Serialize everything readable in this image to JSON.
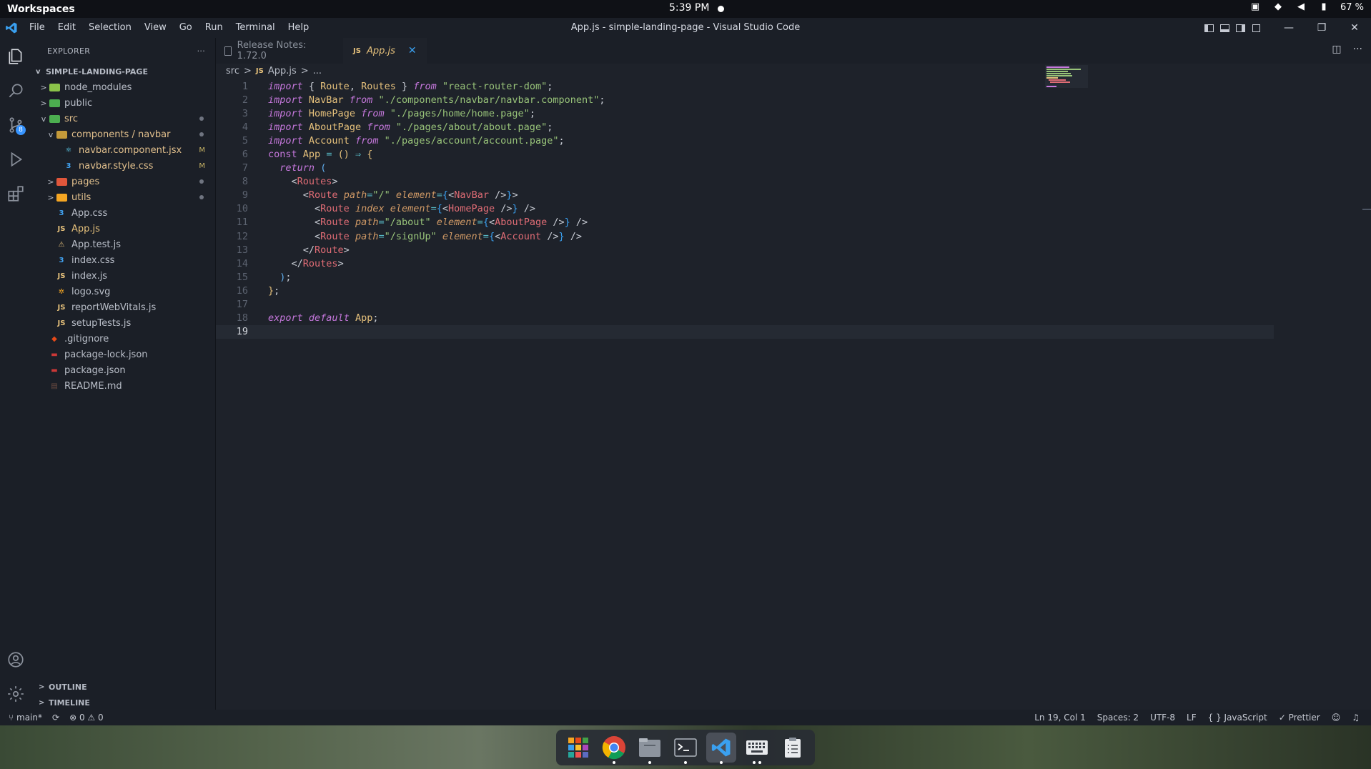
{
  "system_bar": {
    "workspaces": "Workspaces",
    "time": "5:39 PM",
    "battery": "67 %"
  },
  "titlebar": {
    "menu": [
      "File",
      "Edit",
      "Selection",
      "View",
      "Go",
      "Run",
      "Terminal",
      "Help"
    ],
    "window_title": "App.js - simple-landing-page - Visual Studio Code"
  },
  "activity_bar": {
    "source_control_badge": "8"
  },
  "sidebar": {
    "header": "EXPLORER",
    "more": "···",
    "project": "SIMPLE-LANDING-PAGE",
    "tree": [
      {
        "label": "node_modules",
        "indent": 1,
        "chev": ">",
        "icon": "folder",
        "color": "#8bc34a"
      },
      {
        "label": "public",
        "indent": 1,
        "chev": ">",
        "icon": "folder",
        "color": "#4caf50"
      },
      {
        "label": "src",
        "indent": 1,
        "chev": "v",
        "icon": "folder",
        "color": "#4caf50",
        "dot": true,
        "mod": true
      },
      {
        "label": "components / navbar",
        "indent": 2,
        "chev": "v",
        "icon": "folder",
        "color": "#c49a3a",
        "dot": true,
        "mod": true
      },
      {
        "label": "navbar.component.jsx",
        "indent": 3,
        "chev": "",
        "icon": "react",
        "color": "#61dafb",
        "mark": "M",
        "mod": true
      },
      {
        "label": "navbar.style.css",
        "indent": 3,
        "chev": "",
        "icon": "css",
        "color": "#42a5f5",
        "mark": "M",
        "mod": true
      },
      {
        "label": "pages",
        "indent": 2,
        "chev": ">",
        "icon": "folder",
        "color": "#e0563b",
        "dot": true,
        "mod": true
      },
      {
        "label": "utils",
        "indent": 2,
        "chev": ">",
        "icon": "folder",
        "color": "#f5a623",
        "dot": true,
        "mod": true
      },
      {
        "label": "App.css",
        "indent": 2,
        "chev": "",
        "icon": "css",
        "color": "#42a5f5"
      },
      {
        "label": "App.js",
        "indent": 2,
        "chev": "",
        "icon": "js",
        "color": "#e5c07b",
        "selected": true
      },
      {
        "label": "App.test.js",
        "indent": 2,
        "chev": "",
        "icon": "test",
        "color": "#e5c07b"
      },
      {
        "label": "index.css",
        "indent": 2,
        "chev": "",
        "icon": "css",
        "color": "#42a5f5"
      },
      {
        "label": "index.js",
        "indent": 2,
        "chev": "",
        "icon": "js",
        "color": "#e5c07b"
      },
      {
        "label": "logo.svg",
        "indent": 2,
        "chev": "",
        "icon": "svg",
        "color": "#f5a623"
      },
      {
        "label": "reportWebVitals.js",
        "indent": 2,
        "chev": "",
        "icon": "js",
        "color": "#e5c07b"
      },
      {
        "label": "setupTests.js",
        "indent": 2,
        "chev": "",
        "icon": "js",
        "color": "#e5c07b"
      },
      {
        "label": ".gitignore",
        "indent": 1,
        "chev": "",
        "icon": "git",
        "color": "#e64a19"
      },
      {
        "label": "package-lock.json",
        "indent": 1,
        "chev": "",
        "icon": "npm",
        "color": "#cb3837"
      },
      {
        "label": "package.json",
        "indent": 1,
        "chev": "",
        "icon": "npm",
        "color": "#cb3837"
      },
      {
        "label": "README.md",
        "indent": 1,
        "chev": "",
        "icon": "md",
        "color": "#6d4c41"
      }
    ],
    "outline": "OUTLINE",
    "timeline": "TIMELINE"
  },
  "editor": {
    "tabs": [
      {
        "label": "Release Notes: 1.72.0",
        "active": false
      },
      {
        "label": "App.js",
        "active": true
      }
    ],
    "breadcrumb": [
      "src",
      "App.js",
      "..."
    ],
    "current_line": 19,
    "lines": [
      [
        [
          "kw",
          "import"
        ],
        [
          "p",
          " { "
        ],
        [
          "id",
          "Route"
        ],
        [
          "p",
          ", "
        ],
        [
          "id",
          "Routes"
        ],
        [
          "p",
          " } "
        ],
        [
          "kw",
          "from"
        ],
        [
          "p",
          " "
        ],
        [
          "str",
          "\"react-router-dom\""
        ],
        [
          "p",
          ";"
        ]
      ],
      [
        [
          "kw",
          "import"
        ],
        [
          "p",
          " "
        ],
        [
          "id",
          "NavBar"
        ],
        [
          "p",
          " "
        ],
        [
          "kw",
          "from"
        ],
        [
          "p",
          " "
        ],
        [
          "str",
          "\"./components/navbar/navbar.component\""
        ],
        [
          "p",
          ";"
        ]
      ],
      [
        [
          "kw",
          "import"
        ],
        [
          "p",
          " "
        ],
        [
          "id",
          "HomePage"
        ],
        [
          "p",
          " "
        ],
        [
          "kw",
          "from"
        ],
        [
          "p",
          " "
        ],
        [
          "str",
          "\"./pages/home/home.page\""
        ],
        [
          "p",
          ";"
        ]
      ],
      [
        [
          "kw",
          "import"
        ],
        [
          "p",
          " "
        ],
        [
          "id",
          "AboutPage"
        ],
        [
          "p",
          " "
        ],
        [
          "kw",
          "from"
        ],
        [
          "p",
          " "
        ],
        [
          "str",
          "\"./pages/about/about.page\""
        ],
        [
          "p",
          ";"
        ]
      ],
      [
        [
          "kw",
          "import"
        ],
        [
          "p",
          " "
        ],
        [
          "id",
          "Account"
        ],
        [
          "p",
          " "
        ],
        [
          "kw",
          "from"
        ],
        [
          "p",
          " "
        ],
        [
          "str",
          "\"./pages/account/account.page\""
        ],
        [
          "p",
          ";"
        ]
      ],
      [
        [
          "kw2",
          "const"
        ],
        [
          "p",
          " "
        ],
        [
          "id",
          "App"
        ],
        [
          "p",
          " "
        ],
        [
          "op",
          "="
        ],
        [
          "p",
          " "
        ],
        [
          "br2",
          "()"
        ],
        [
          "p",
          " "
        ],
        [
          "op",
          "⇒"
        ],
        [
          "p",
          " "
        ],
        [
          "br2",
          "{"
        ]
      ],
      [
        [
          "p",
          "  "
        ],
        [
          "kw",
          "return"
        ],
        [
          "p",
          " "
        ],
        [
          "fn",
          "("
        ]
      ],
      [
        [
          "p",
          "    <"
        ],
        [
          "tag",
          "Routes"
        ],
        [
          "p",
          ">"
        ]
      ],
      [
        [
          "p",
          "      <"
        ],
        [
          "tag",
          "Route"
        ],
        [
          "p",
          " "
        ],
        [
          "attr",
          "path"
        ],
        [
          "op",
          "="
        ],
        [
          "str",
          "\"/\""
        ],
        [
          "p",
          " "
        ],
        [
          "attr",
          "element"
        ],
        [
          "op",
          "="
        ],
        [
          "br",
          "{"
        ],
        [
          "p",
          "<"
        ],
        [
          "tag",
          "NavBar"
        ],
        [
          "p",
          " />"
        ],
        [
          "br",
          "}"
        ],
        [
          "p",
          ">"
        ]
      ],
      [
        [
          "p",
          "        <"
        ],
        [
          "tag",
          "Route"
        ],
        [
          "p",
          " "
        ],
        [
          "attr",
          "index"
        ],
        [
          "p",
          " "
        ],
        [
          "attr",
          "element"
        ],
        [
          "op",
          "="
        ],
        [
          "br",
          "{"
        ],
        [
          "p",
          "<"
        ],
        [
          "tag",
          "HomePage"
        ],
        [
          "p",
          " />"
        ],
        [
          "br",
          "}"
        ],
        [
          "p",
          " />"
        ]
      ],
      [
        [
          "p",
          "        <"
        ],
        [
          "tag",
          "Route"
        ],
        [
          "p",
          " "
        ],
        [
          "attr",
          "path"
        ],
        [
          "op",
          "="
        ],
        [
          "str",
          "\"/about\""
        ],
        [
          "p",
          " "
        ],
        [
          "attr",
          "element"
        ],
        [
          "op",
          "="
        ],
        [
          "br",
          "{"
        ],
        [
          "p",
          "<"
        ],
        [
          "tag",
          "AboutPage"
        ],
        [
          "p",
          " />"
        ],
        [
          "br",
          "}"
        ],
        [
          "p",
          " />"
        ]
      ],
      [
        [
          "p",
          "        <"
        ],
        [
          "tag",
          "Route"
        ],
        [
          "p",
          " "
        ],
        [
          "attr",
          "path"
        ],
        [
          "op",
          "="
        ],
        [
          "str",
          "\"/signUp\""
        ],
        [
          "p",
          " "
        ],
        [
          "attr",
          "element"
        ],
        [
          "op",
          "="
        ],
        [
          "br",
          "{"
        ],
        [
          "p",
          "<"
        ],
        [
          "tag",
          "Account"
        ],
        [
          "p",
          " />"
        ],
        [
          "br",
          "}"
        ],
        [
          "p",
          " />"
        ]
      ],
      [
        [
          "p",
          "      </"
        ],
        [
          "tag",
          "Route"
        ],
        [
          "p",
          ">"
        ]
      ],
      [
        [
          "p",
          "    </"
        ],
        [
          "tag",
          "Routes"
        ],
        [
          "p",
          ">"
        ]
      ],
      [
        [
          "p",
          "  "
        ],
        [
          "fn",
          ")"
        ],
        [
          "p",
          ";"
        ]
      ],
      [
        [
          "br2",
          "}"
        ],
        [
          "p",
          ";"
        ]
      ],
      [],
      [
        [
          "kw",
          "export"
        ],
        [
          "p",
          " "
        ],
        [
          "kw",
          "default"
        ],
        [
          "p",
          " "
        ],
        [
          "id",
          "App"
        ],
        [
          "p",
          ";"
        ]
      ],
      []
    ]
  },
  "status_bar": {
    "branch": "main*",
    "errors": "0",
    "warnings": "0",
    "position": "Ln 19, Col 1",
    "spaces": "Spaces: 2",
    "encoding": "UTF-8",
    "eol": "LF",
    "language": "{ } JavaScript",
    "formatter": "✓ Prettier"
  },
  "dock": {
    "apps": [
      "app-grid",
      "chrome",
      "files",
      "terminal",
      "vscode",
      "keyboard",
      "clipboard"
    ]
  }
}
